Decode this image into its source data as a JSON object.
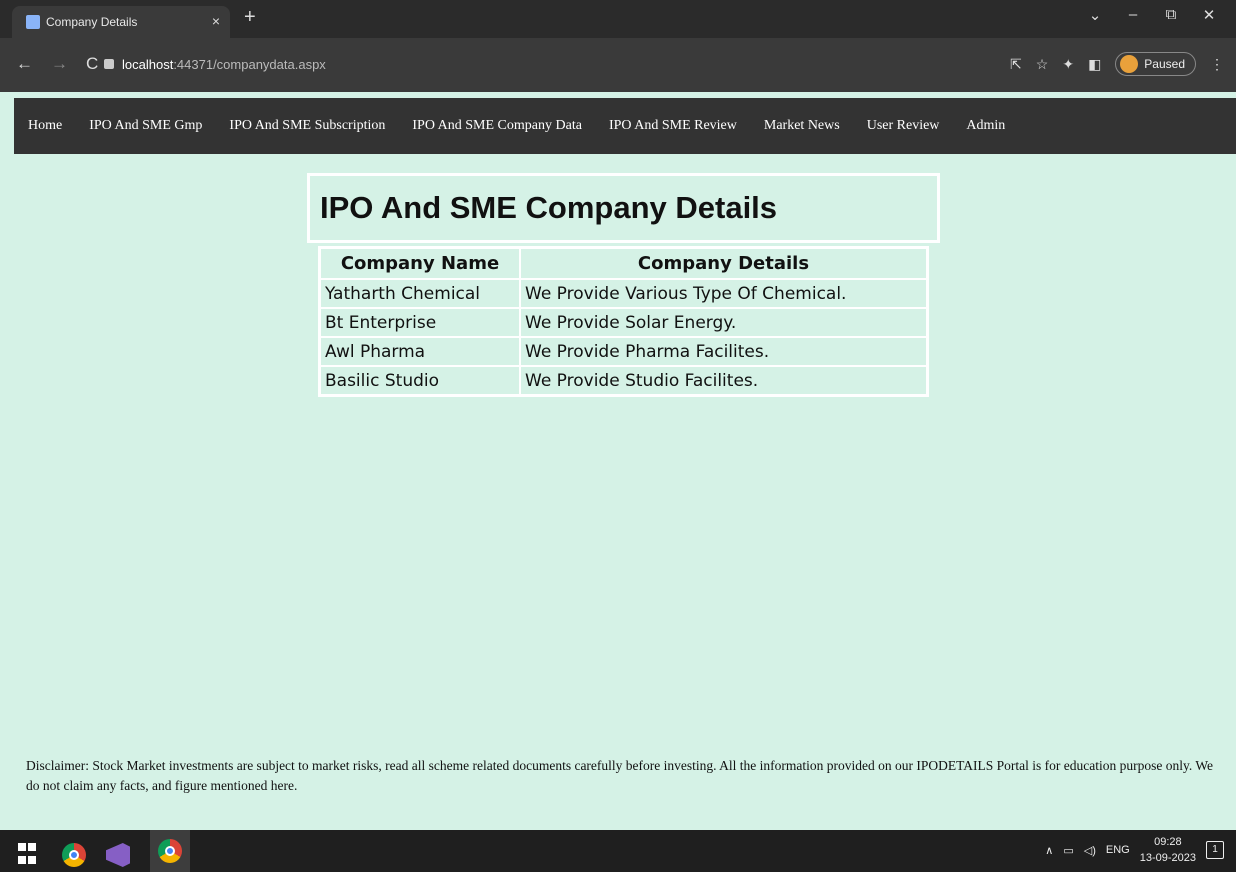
{
  "browser": {
    "tab_title": "Company Details",
    "tab_close": "×",
    "new_tab": "+",
    "url_host": "localhost",
    "url_path": ":44371/companydata.aspx",
    "profile_label": "Paused",
    "window_controls": [
      "⌄",
      "–",
      "⧉",
      "✕"
    ]
  },
  "site_nav": {
    "items": [
      "Home",
      "IPO And SME Gmp",
      "IPO And SME Subscription",
      "IPO And SME Company Data",
      "IPO And SME Review",
      "Market News",
      "User Review",
      "Admin"
    ]
  },
  "page": {
    "title": "IPO And SME Company Details",
    "table": {
      "headers": [
        "Company Name",
        "Company Details"
      ],
      "rows": [
        [
          "Yatharth Chemical",
          "We Provide Various Type Of Chemical."
        ],
        [
          "Bt Enterprise",
          "We Provide Solar Energy."
        ],
        [
          "Awl Pharma",
          "We Provide Pharma Facilites."
        ],
        [
          "Basilic Studio",
          "We Provide Studio Facilites."
        ]
      ]
    },
    "disclaimer": "Disclaimer: Stock Market investments are subject to market risks, read all scheme related documents carefully before investing. All the information provided on our IPODETAILS Portal is for education purpose only. We do not claim any facts, and figure mentioned here."
  },
  "taskbar": {
    "language": "ENG",
    "time": "09:28",
    "date": "13-09-2023",
    "notifications": "1"
  }
}
